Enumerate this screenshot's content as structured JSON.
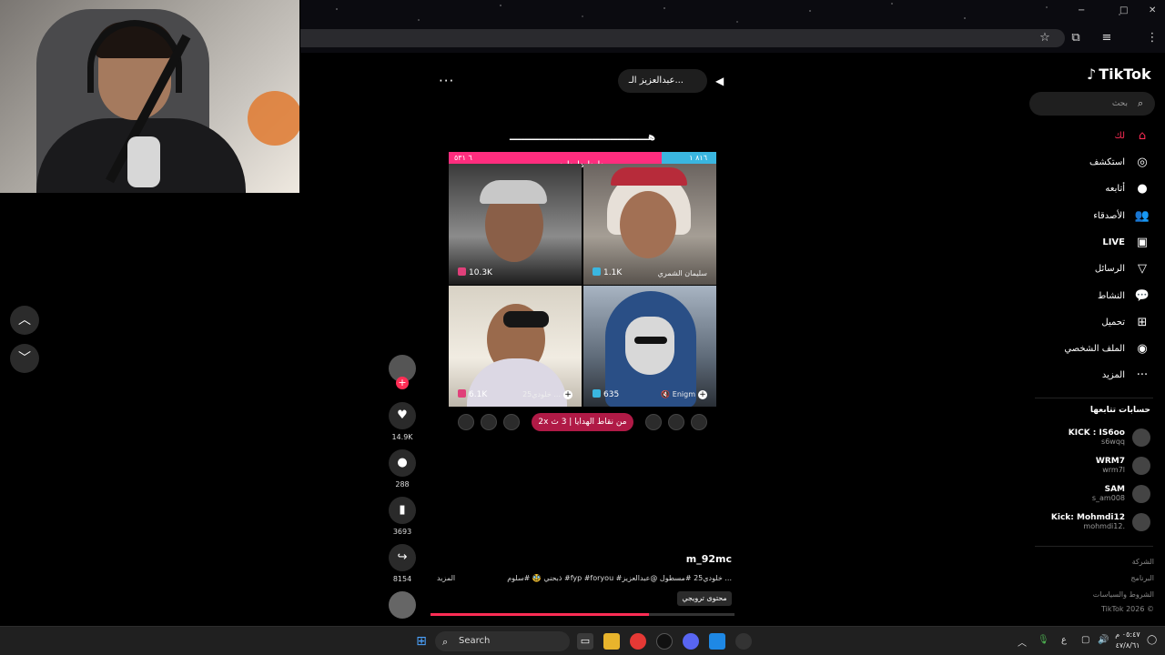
{
  "browser": {
    "controls": [
      "−",
      "□",
      "✕"
    ]
  },
  "video": {
    "host_name": "عبدالعزيز الـ...",
    "more": "···",
    "banner": "هـــــــــــــــــــــــــــــــــــــ",
    "pk": {
      "left_score": "٦ ٥٣١",
      "right_score": "٨١٦ ١",
      "sub": "ـدلـدلـدلـدلـد"
    },
    "tiles": [
      {
        "score": "10.3K",
        "name": "",
        "color": "#e0407a"
      },
      {
        "score": "1.1K",
        "name": "سليمان الشمري",
        "color": "#3ab6e0"
      },
      {
        "score": "6.1K",
        "name": "خلودي25 ...",
        "color": "#e0407a"
      },
      {
        "score": "635",
        "name": "Enigm",
        "color": "#3ab6e0"
      }
    ],
    "gift_bar": "2x من نقاط الهدايا | 3 ث",
    "author": "m_92mc",
    "caption": "ذبحني 🥸 #سلوم #fyp #foryou #خلودي25 #مسطول @عبدالعزيز ...",
    "more_label": "المزيد",
    "tag": "محتوى ترويجي",
    "progress": 0.72
  },
  "actions": [
    {
      "icon": "♥",
      "count": "14.9K",
      "name": "like"
    },
    {
      "icon": "💬",
      "count": "288",
      "name": "comment"
    },
    {
      "icon": "🔖",
      "count": "3693",
      "name": "bookmark"
    },
    {
      "icon": "↪",
      "count": "8154",
      "name": "share"
    }
  ],
  "sidebar": {
    "logo": "TikTok",
    "search_placeholder": "بحث",
    "items": [
      {
        "label": "لك",
        "icon": "⌂",
        "accent": true
      },
      {
        "label": "استكشف",
        "icon": "◎"
      },
      {
        "label": "أتابعه",
        "icon": "●"
      },
      {
        "label": "الأصدقاء",
        "icon": "👥"
      },
      {
        "label": "LIVE",
        "icon": "▣"
      },
      {
        "label": "الرسائل",
        "icon": "▽"
      },
      {
        "label": "النشاط",
        "icon": "💬"
      },
      {
        "label": "تحميل",
        "icon": "⊞"
      },
      {
        "label": "الملف الشخصي",
        "icon": "◉"
      },
      {
        "label": "المزيد",
        "icon": "···"
      }
    ],
    "following_title": "حسابات تتابعها",
    "following": [
      {
        "name": "KICK : IS6oo",
        "user": "s6wqq"
      },
      {
        "name": "WRM7",
        "user": "wrm7l"
      },
      {
        "name": "SAM",
        "user": "s_am008"
      },
      {
        "name": "Kick: Mohmdi12",
        "user": "mohmdi12."
      }
    ],
    "footer": [
      "الشركة",
      "البرنامج",
      "الشروط والسياسات",
      "TikTok 2026 ©"
    ]
  },
  "taskbar": {
    "search": "Search",
    "clock_time": "٠٥:٤٧ م",
    "clock_date": "٤٧/٨/٦١",
    "lang": "ع"
  }
}
